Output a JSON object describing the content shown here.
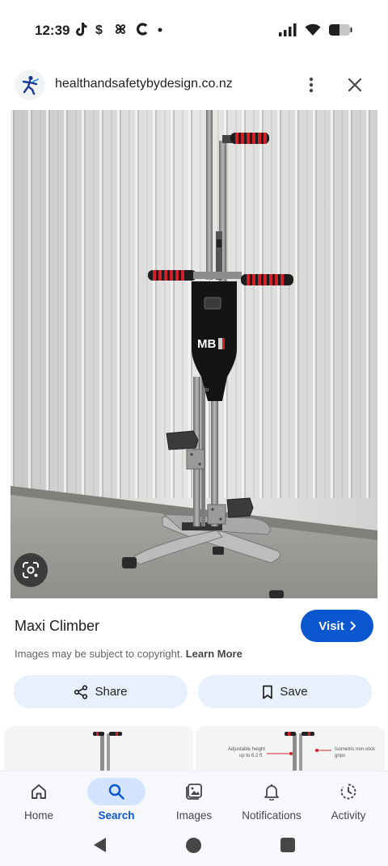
{
  "status_bar": {
    "time": "12:39",
    "left_icons": [
      "tiktok-icon",
      "cashapp-icon",
      "pinwheel-icon",
      "c-app-icon",
      "notification-dot-icon"
    ],
    "right_icons": [
      "signal-icon",
      "wifi-icon",
      "battery-icon"
    ]
  },
  "header": {
    "domain": "healthandsafetybydesign.co.nz",
    "logo_icon": "site-logo-icon",
    "more_icon": "more-vert-icon",
    "close_icon": "close-icon"
  },
  "image_overlay": {
    "brand_text": "MB",
    "lens_icon": "google-lens-icon"
  },
  "result": {
    "title": "Maxi Climber",
    "visit_label": "Visit",
    "copyright_text": "Images may be subject to copyright.",
    "learn_more_label": "Learn More"
  },
  "actions": {
    "share_label": "Share",
    "save_label": "Save"
  },
  "related": {
    "annotation_1": "Adjustable height",
    "annotation_2": "up to 6.2 ft",
    "annotation_3": "Isometric non-stick",
    "annotation_4": "grips"
  },
  "bottom_nav": {
    "items": [
      {
        "label": "Home",
        "icon": "home-icon"
      },
      {
        "label": "Search",
        "icon": "search-icon"
      },
      {
        "label": "Images",
        "icon": "images-icon"
      },
      {
        "label": "Notifications",
        "icon": "bell-icon"
      },
      {
        "label": "Activity",
        "icon": "activity-icon"
      }
    ],
    "active": "Search"
  },
  "colors": {
    "accent": "#0b57d0",
    "action_bg": "#e8f0fe",
    "nav_active_bg": "#d3e3fd",
    "nav_bg": "#f6f8fc",
    "grip_red": "#d01f28"
  }
}
